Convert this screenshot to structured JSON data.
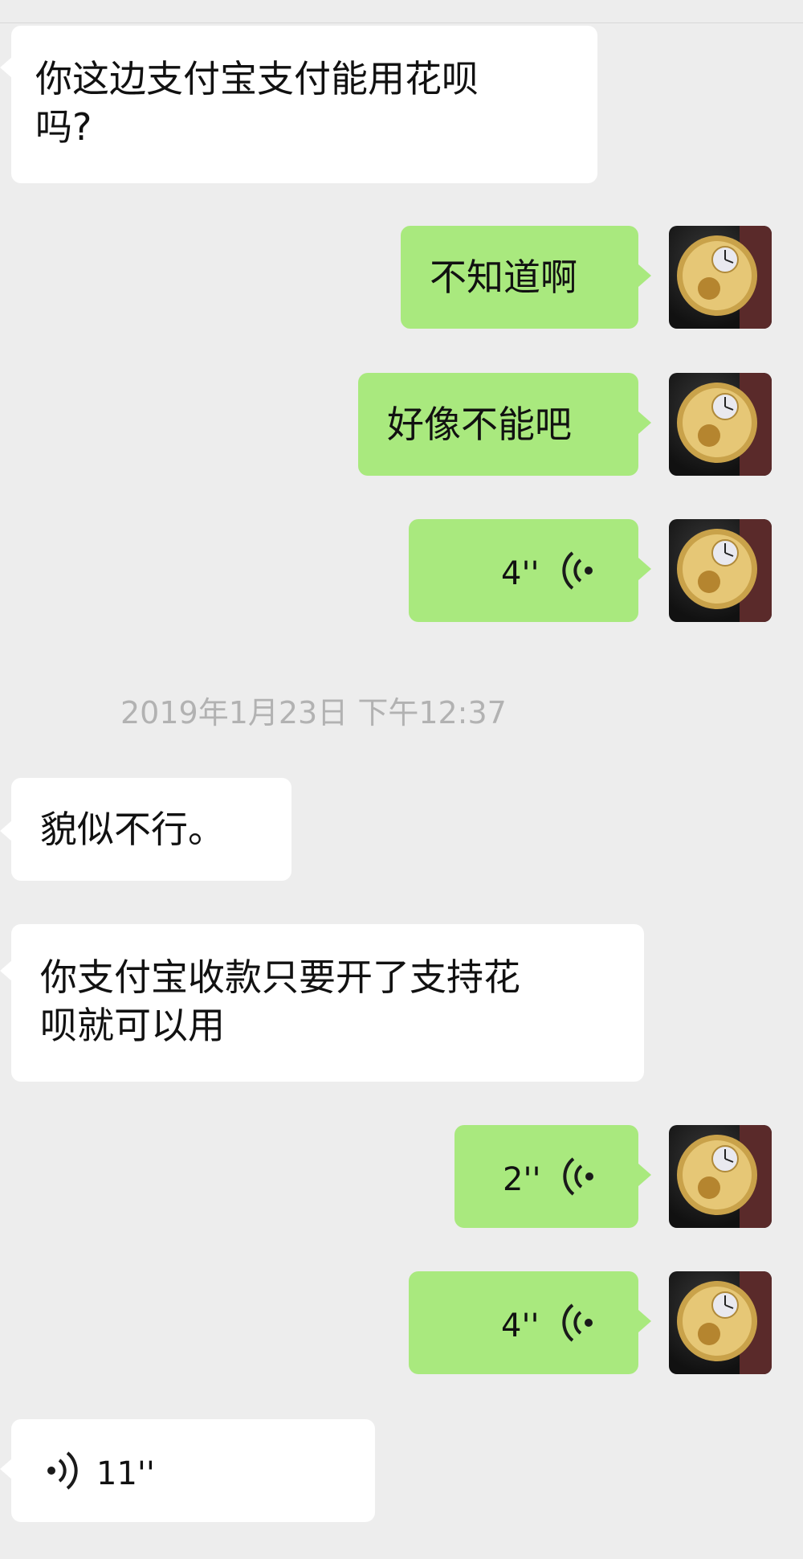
{
  "messages": [
    {
      "side": "in",
      "text": "你这边支付宝支付能用花呗\n吗?"
    },
    {
      "side": "out",
      "text": "不知道啊"
    },
    {
      "side": "out",
      "text": "好像不能吧"
    },
    {
      "side": "out",
      "voice_duration": "4''"
    },
    {
      "side": "in",
      "text": "貌似不行。"
    },
    {
      "side": "in",
      "text": "你支付宝收款只要开了支持花\n呗就可以用"
    },
    {
      "side": "out",
      "voice_duration": "2''"
    },
    {
      "side": "out",
      "voice_duration": "4''"
    },
    {
      "side": "in",
      "voice_duration": "11''"
    }
  ],
  "timestamp": "2019年1月23日 下午12:37",
  "colors": {
    "outgoing_bubble": "#a9e97e",
    "incoming_bubble": "#ffffff",
    "background": "#ededed"
  },
  "icons": {
    "avatar": "watch-avatar-icon",
    "voice": "voice-wave-icon"
  }
}
